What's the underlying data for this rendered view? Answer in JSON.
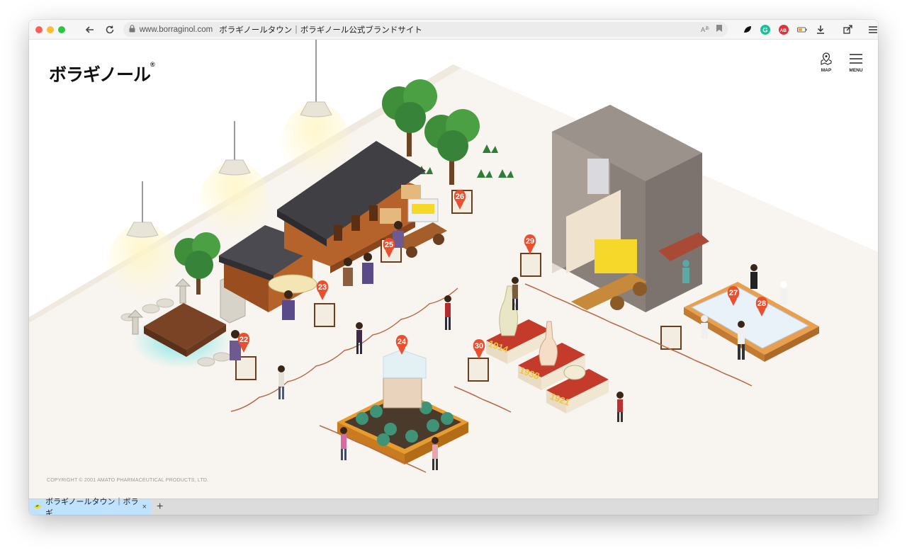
{
  "browser": {
    "url_host": "www.borraginol.com",
    "url_title": "ボラギノールタウン｜ボラギノール公式ブランドサイト",
    "tab_label": "ボラギノールタウン｜ボラギ",
    "new_tab_label": "+",
    "tab_close_label": "×"
  },
  "site": {
    "logo_text": "ボラギノール",
    "logo_mark": "®",
    "map_label": "MAP",
    "menu_label": "MENU",
    "copyright": "COPYRIGHT © 2001 AMATO PHARMACEUTICAL PRODUCTS, LTD."
  },
  "pins": [
    "22",
    "23",
    "24",
    "25",
    "26",
    "27",
    "28",
    "29",
    "30"
  ],
  "exhibit_years": [
    "1914",
    "1938",
    "1921"
  ],
  "colors": {
    "pin": "#e8502f",
    "floor": "#f8f5f0",
    "wood": "#b5632b",
    "roof": "#3f3f44",
    "tree": "#3f8f3a",
    "brand_yellow": "#f6d82a"
  }
}
